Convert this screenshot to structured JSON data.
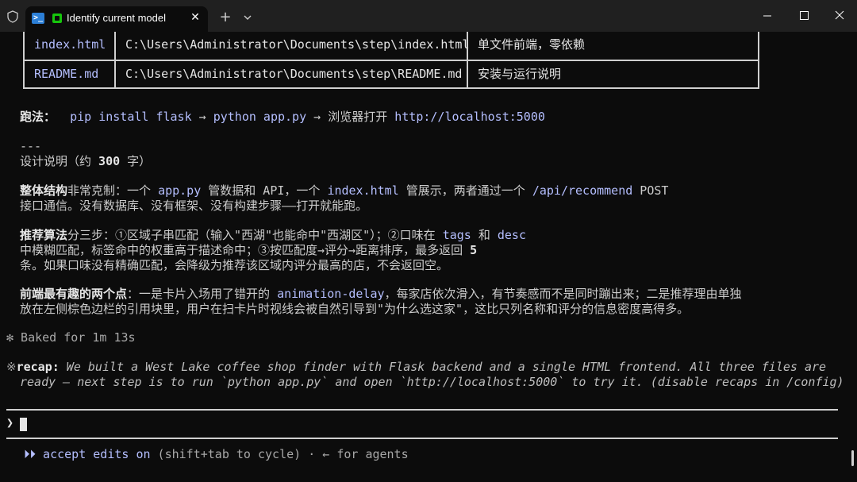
{
  "titlebar": {
    "tab_title": "Identify current model",
    "tab_close": "✕",
    "new_tab": "+"
  },
  "table": {
    "rows": [
      [
        "index.html",
        "C:\\Users\\Administrator\\Documents\\step\\index.html",
        "单文件前端，零依赖"
      ],
      [
        "README.md",
        "C:\\Users\\Administrator\\Documents\\step\\README.md",
        "安装与运行说明"
      ]
    ]
  },
  "run": {
    "label": "跑法：",
    "cmd1": "pip install flask",
    "arrow1": " → ",
    "cmd2": "python app.py",
    "arrow2": " → 浏览器打开 ",
    "url": "http://localhost:5000"
  },
  "divider": "---",
  "design_heading": {
    "prefix": "设计说明（约 ",
    "count": "300",
    "suffix": " 字）"
  },
  "p1": {
    "bold": "整体结构",
    "t1": "非常克制：一个 ",
    "code1": "app.py",
    "t2": " 管数据和 API，一个 ",
    "code2": "index.html",
    "t3": " 管展示，两者通过一个 ",
    "code3": "/api/recommend",
    "t4": " POST",
    "line2": "接口通信。没有数据库、没有框架、没有构建步骤——打开就能跑。"
  },
  "p2": {
    "bold": "推荐算法",
    "t1": "分三步：①区域子串匹配（输入\"西湖\"也能命中\"西湖区\"）；②口味在 ",
    "code1": "tags",
    "t2": " 和 ",
    "code2": "desc",
    "line2": "中模糊匹配，标签命中的权重高于描述命中；③按匹配度→评分→距离排序，最多返回 ",
    "num": "5",
    "line3": "条。如果口味没有精确匹配，会降级为推荐该区域内评分最高的店，不会返回空。"
  },
  "p3": {
    "bold": "前端最有趣的两个点",
    "t1": "：一是卡片入场用了错开的 ",
    "code1": "animation-delay",
    "t2": "，每家店依次滑入，有节奏感而不是同时蹦出来；二是推荐理由单独",
    "line2": "放在左侧棕色边栏的引用块里，用户在扫卡片时视线会被自然引导到\"为什么选这家\"，这比只列名称和评分的信息密度高得多。"
  },
  "baked": {
    "symbol": "✻",
    "text": " Baked for 1m 13s"
  },
  "recap": {
    "symbol": "※",
    "label": "recap:",
    "line1": " We built a West Lake coffee shop finder with Flask backend and a single HTML frontend. All three files are",
    "line2": "ready — next step is to run `python app.py` and open `http://localhost:5000` to try it. (disable recaps in /config)"
  },
  "prompt": {
    "symbol": "❯"
  },
  "status": {
    "arrows": "⏵⏵",
    "accept_edits": " accept edits on",
    "hint": " (shift+tab to cycle) · ← for agents"
  }
}
